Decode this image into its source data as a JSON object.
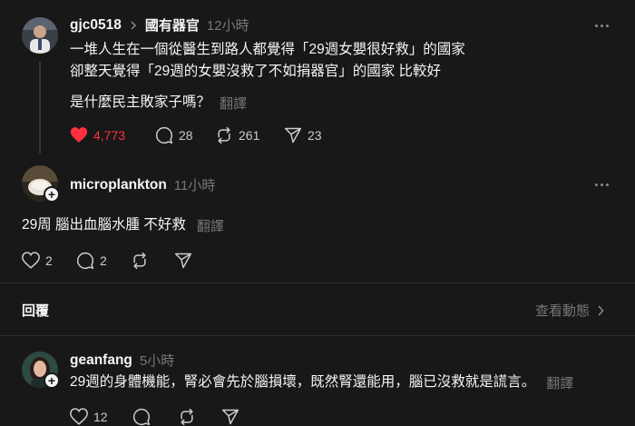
{
  "post1": {
    "username": "gjc0518",
    "topic": "國有器官",
    "time": "12小時",
    "lines": [
      "一堆人生在一個從醫生到路人都覺得「29週女嬰很好救」的國家",
      "卻整天覺得「29週的女嬰沒救了不如捐器官」的國家 比較好"
    ],
    "question": "是什麼民主敗家子嗎？",
    "translate": "翻譯",
    "likes": "4,773",
    "replies": "28",
    "reposts": "261",
    "shares": "23",
    "liked_color": "#ff3040"
  },
  "post2": {
    "username": "microplankton",
    "time": "11小時",
    "text": "29周 腦出血腦水腫 不好救",
    "translate": "翻譯",
    "likes": "2",
    "replies": "2"
  },
  "replies_section": {
    "label": "回覆",
    "view_activity": "查看動態"
  },
  "post3": {
    "username": "geanfang",
    "time": "5小時",
    "text": "29週的身體機能，腎必會先於腦損壞，既然腎還能用，腦已沒救就是謊言。",
    "translate": "翻譯",
    "likes": "12"
  },
  "icons": {
    "more": "more-icon",
    "heart": "heart-icon",
    "comment": "comment-icon",
    "repost": "repost-icon",
    "share": "share-icon",
    "follow": "plus-icon",
    "chevron": "chevron-right-icon"
  }
}
